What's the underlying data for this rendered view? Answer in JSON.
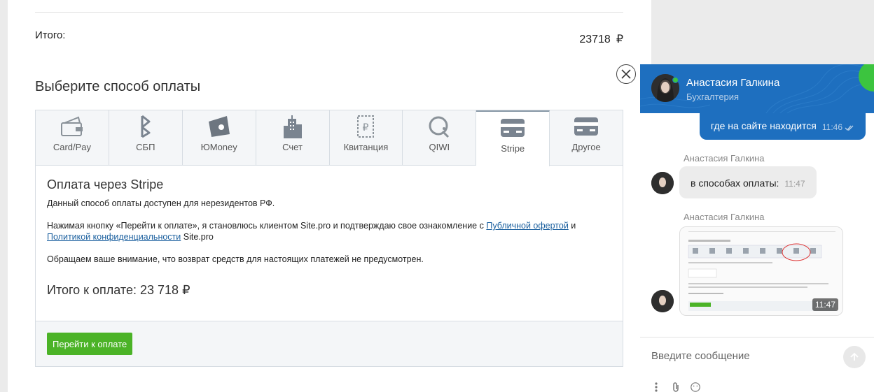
{
  "order": {
    "total_label": "Итого:",
    "total_value": "23718",
    "currency": "₽"
  },
  "payment": {
    "title": "Выберите способ оплаты",
    "tabs": [
      {
        "label": "Card/Pay",
        "icon": "wallet-icon"
      },
      {
        "label": "СБП",
        "icon": "sbp-icon"
      },
      {
        "label": "ЮMoney",
        "icon": "yumoney-icon"
      },
      {
        "label": "Счет",
        "icon": "building-icon"
      },
      {
        "label": "Квитанция",
        "icon": "receipt-icon"
      },
      {
        "label": "QIWI",
        "icon": "qiwi-icon"
      },
      {
        "label": "Stripe",
        "icon": "card-icon",
        "active": true
      },
      {
        "label": "Другое",
        "icon": "card-icon"
      }
    ],
    "method_title": "Оплата через Stripe",
    "p1": "Данный способ оплаты доступен для нерезидентов РФ.",
    "p2_before": "Нажимая кнопку «Перейти к оплате», я становлюсь клиентом Site.pro и подтверждаю свое ознакомление с ",
    "p2_link1": "Публичной офертой",
    "p2_mid": " и ",
    "p2_link2": "Политикой конфиденциальности",
    "p2_after": " Site.pro",
    "p3": "Обращаем ваше внимание, что возврат средств для настоящих платежей не предусмотрен.",
    "total_text": "Итого к оплате: 23 718",
    "button_label": "Перейти к оплате"
  },
  "chat": {
    "agent_name": "Анастасия Галкина",
    "agent_role": "Бухгалтерия",
    "colors": {
      "header": "#1e6fbf",
      "online": "#3cc43f"
    },
    "messages": [
      {
        "type": "out",
        "text": "где на сайте находится",
        "time": "11:46"
      },
      {
        "type": "in",
        "sender": "Анастасия Галкина",
        "text": "в способах оплаты:",
        "time": "11:47"
      },
      {
        "type": "in-image",
        "sender": "Анастасия Галкина",
        "time": "11:47"
      }
    ],
    "input_placeholder": "Введите сообщение"
  }
}
